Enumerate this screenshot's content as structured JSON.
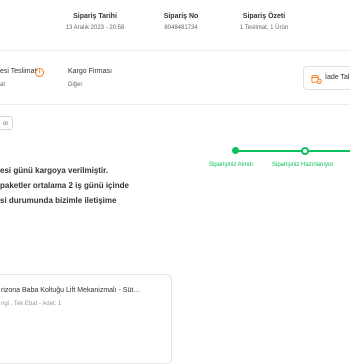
{
  "order_summary": {
    "date_label": "Sipariş Tarihi",
    "date_value": "13 Aralık 2023 - 20:58",
    "number_label": "Sipariş No",
    "number_value": "8048481734",
    "summary_label": "Sipariş Özeti",
    "summary_value": "1 Teslimat, 1 Ürün"
  },
  "delivery": {
    "type_label": "esi Teslimat",
    "type_sub": "at",
    "cargo_label": "Kargo Firması",
    "cargo_value": "Diğer",
    "return_button": "İade Tal"
  },
  "chip": {
    "label": "or"
  },
  "message": {
    "line1": "esi günü kargoya verilmiştir.",
    "line2": "paketler ortalama 2 iş günü içinde",
    "line3": "si durumunda bizimle iletişime"
  },
  "tracker": {
    "steps": [
      {
        "label": "Siparişiniz Alındı",
        "state": "done"
      },
      {
        "label": "Siparişiniz Hazırlanıyor",
        "state": "current"
      }
    ],
    "color": "#0bc15c"
  },
  "product": {
    "name": "rizona Baba Koltuğu Lift Mekanizmalı - Süt…",
    "meta": "ngi , Tek Ebat - Adet: 1"
  },
  "colors": {
    "accent": "#f27a1a",
    "success": "#0bc15c"
  }
}
